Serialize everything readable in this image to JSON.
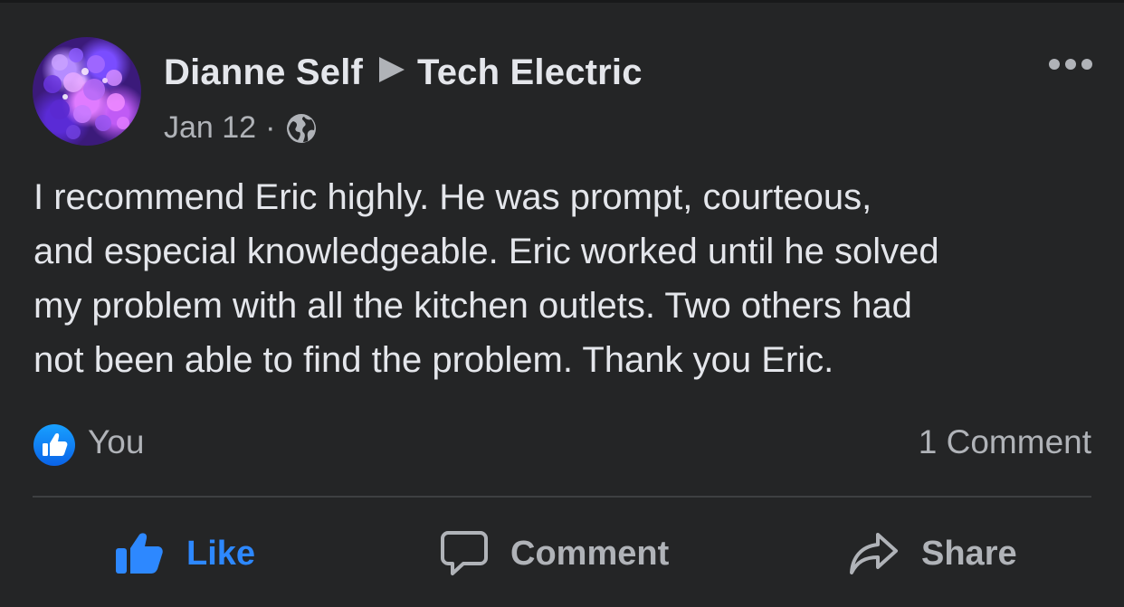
{
  "post": {
    "author": "Dianne Self",
    "target_page": "Tech Electric",
    "date": "Jan 12",
    "separator": "·",
    "audience_icon": "globe-icon",
    "more_icon": "more-horizontal-icon",
    "text": "I recommend Eric highly.  He was prompt, courteous,\nand especial knowledgeable.  Eric worked until he solved\nmy problem with all the kitchen outlets.  Two others had\nnot been able to find the problem.  Thank you Eric.",
    "reactions": {
      "icon": "like-badge-icon",
      "reactors": "You",
      "comment_count": "1 Comment"
    },
    "actions": {
      "like": "Like",
      "comment": "Comment",
      "share": "Share"
    }
  },
  "colors": {
    "background": "#242526",
    "primary_text": "#e4e6eb",
    "secondary_text": "#b0b3b8",
    "accent_blue": "#2d88ff",
    "divider": "#3e4042"
  }
}
